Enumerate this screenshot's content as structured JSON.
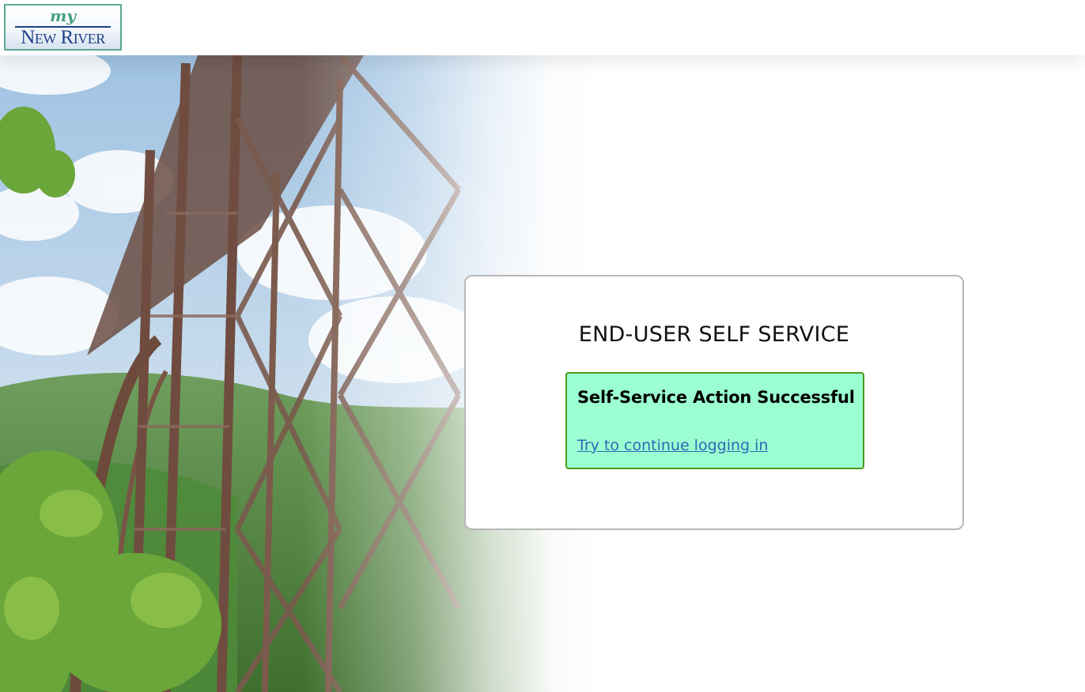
{
  "header": {
    "logo": {
      "my_text": "my",
      "name_text": "New River"
    }
  },
  "card": {
    "title": "END-USER SELF SERVICE",
    "alert": {
      "title": "Self-Service Action Successful",
      "link_label": "Try to continue logging in"
    }
  },
  "colors": {
    "alert_background": "#9bffd2",
    "alert_border": "#4e9a17",
    "link": "#2f68b5",
    "logo_accent": "#46a07c",
    "logo_navy": "#1f3f8a"
  },
  "icons": [
    "bridge-background-image"
  ]
}
